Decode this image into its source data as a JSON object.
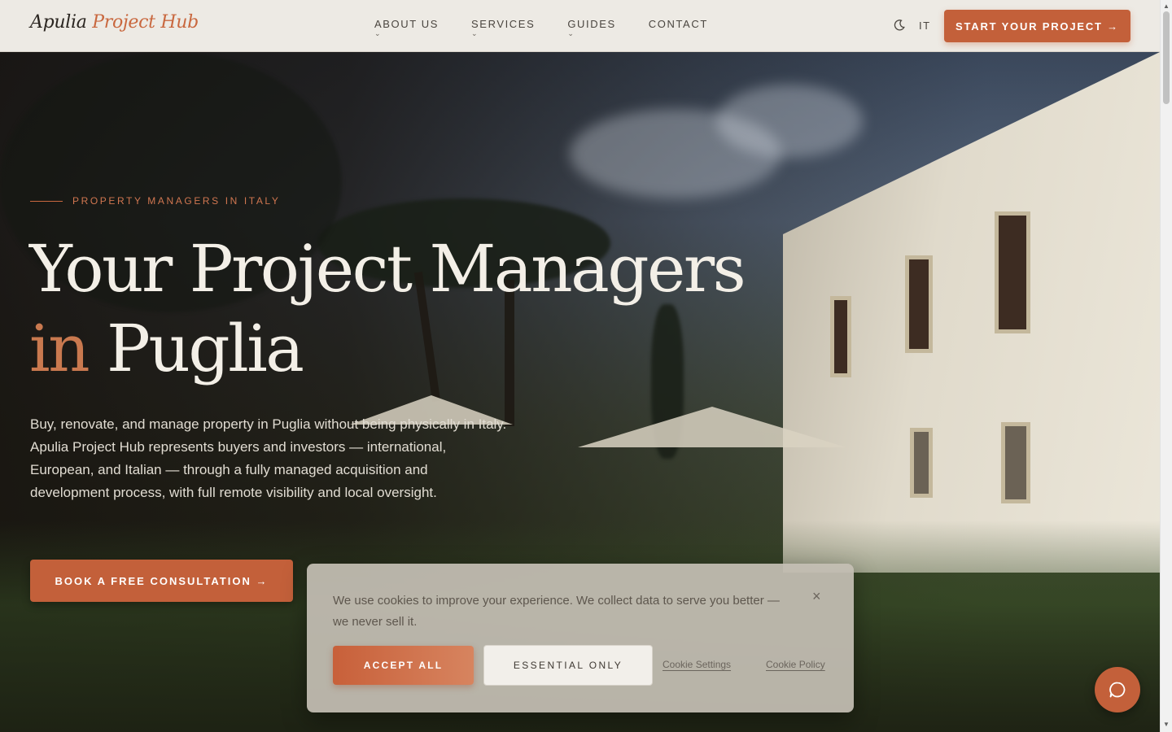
{
  "header": {
    "logo_main": "Apulia",
    "logo_accent": "Project Hub",
    "nav": [
      {
        "label": "ABOUT US",
        "chevron": "⌄"
      },
      {
        "label": "SERVICES",
        "chevron": "⌄"
      },
      {
        "label": "GUIDES",
        "chevron": "⌄"
      },
      {
        "label": "CONTACT",
        "chevron": ""
      }
    ],
    "language": "IT",
    "theme_icon": "moon-icon",
    "cta_label": "START YOUR PROJECT →"
  },
  "hero": {
    "eyebrow": "PROPERTY MANAGERS IN ITALY",
    "headline_line1": "Your Project Managers",
    "headline_accent": "in",
    "headline_line2_rest": " Puglia",
    "lede": "Buy, renovate, and manage property in Puglia without being physically in Italy. Apulia Project Hub represents buyers and investors — international, European, and Italian — through a fully managed acquisition and development process, with full remote visibility and local oversight.",
    "book_label": "BOOK A FREE CONSULTATION →"
  },
  "cookie": {
    "text": "We use cookies to improve your experience. We collect data to serve you better — we never sell it.",
    "close_glyph": "×",
    "accept_label": "ACCEPT ALL",
    "essential_label": "ESSENTIAL ONLY",
    "settings_label": "Cookie Settings",
    "policy_label": "Cookie Policy"
  },
  "chat": {
    "icon": "chat-bubble-icon"
  },
  "colors": {
    "accent": "#c3603a",
    "header_bg": "#edeae4",
    "hero_text": "#f3efe7"
  }
}
